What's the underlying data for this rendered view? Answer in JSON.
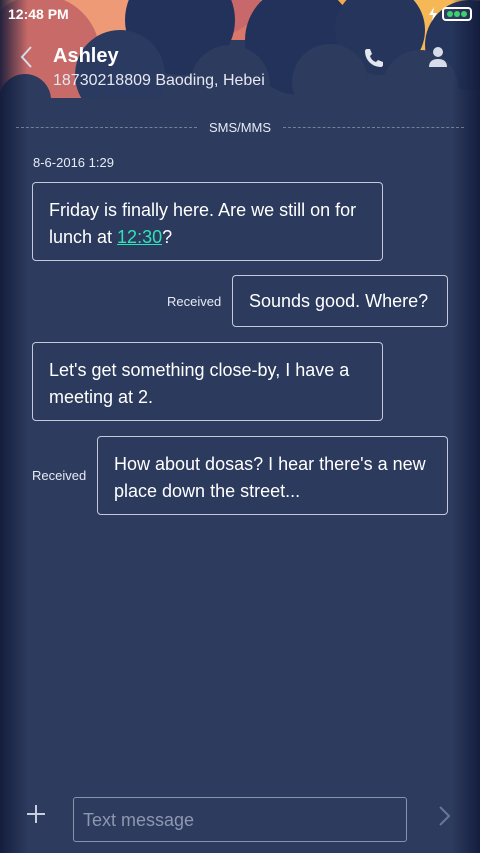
{
  "status": {
    "time": "12:48 PM"
  },
  "header": {
    "name": "Ashley",
    "subtitle": "18730218809 Baoding, Hebei"
  },
  "channel_label": "SMS/MMS",
  "timestamp": "8-6-2016 1:29",
  "messages": [
    {
      "part1": "Friday is finally here. Are we still on for lunch at ",
      "link": "12:30",
      "part2": "?"
    },
    {
      "text": "Sounds good. Where?",
      "status": "Received"
    },
    {
      "text": "Let's get something close-by, I have a meeting at 2."
    },
    {
      "text": "How about dosas? I hear there's a new place down the street...",
      "status": "Received"
    }
  ],
  "compose": {
    "placeholder": "Text message"
  },
  "colors": {
    "background": "#2c3b5e",
    "link": "#2fe3b9",
    "battery": "#3bd16f",
    "cloud_orange": "#f0a23a",
    "cloud_salmon": "#d9786a",
    "cloud_navy": "#25355a"
  },
  "icons": [
    "back-icon",
    "phone-icon",
    "contact-icon",
    "plus-icon",
    "send-icon",
    "battery-icon",
    "charging-icon"
  ]
}
